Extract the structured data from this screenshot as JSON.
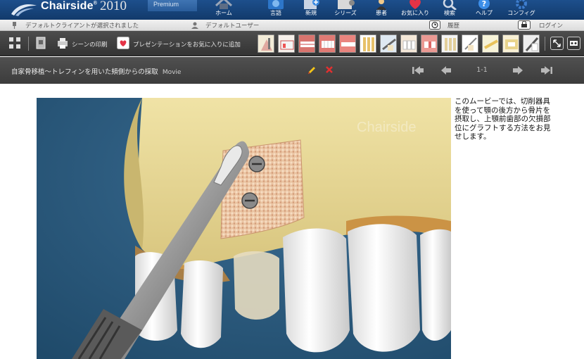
{
  "app": {
    "name": "Chairside",
    "year": "2010",
    "edition": "Premium"
  },
  "nav": [
    {
      "label": "ホーム",
      "icon": "home-icon"
    },
    {
      "label": "言語",
      "icon": "globe-icon"
    },
    {
      "label": "新規",
      "icon": "new-icon"
    },
    {
      "label": "シリーズ",
      "icon": "film-icon"
    },
    {
      "label": "患者",
      "icon": "patient-icon"
    },
    {
      "label": "お気に入り",
      "icon": "heart-icon"
    },
    {
      "label": "検索",
      "icon": "search-icon"
    },
    {
      "label": "ヘルプ",
      "icon": "help-icon"
    },
    {
      "label": "コンフィグ",
      "icon": "gear-icon"
    }
  ],
  "status": {
    "client": "デフォルトクライアントが選択されました",
    "user": "デフォルトユーザー",
    "history": "履歴",
    "login": "ログイン"
  },
  "toolbar": {
    "print_scene": "シーンの印刷",
    "add_favorite": "プレゼンテーションをお気に入りに追加"
  },
  "movie": {
    "title": "自家骨移植～トレフィンを用いた頬側からの採取",
    "type": "Movie",
    "page": "1-1",
    "watermark": "Chairside",
    "description": "このムービーでは、切削器具を使って顎の後方から骨片を摂取し、上顎前歯部の欠損部位にグラフトする方法をお見せします。"
  },
  "colors": {
    "header_blue": "#1d4f8c",
    "toolbar_dark": "#3c3c3c",
    "bone": "#e6d590",
    "background_blue": "#2b5979"
  }
}
